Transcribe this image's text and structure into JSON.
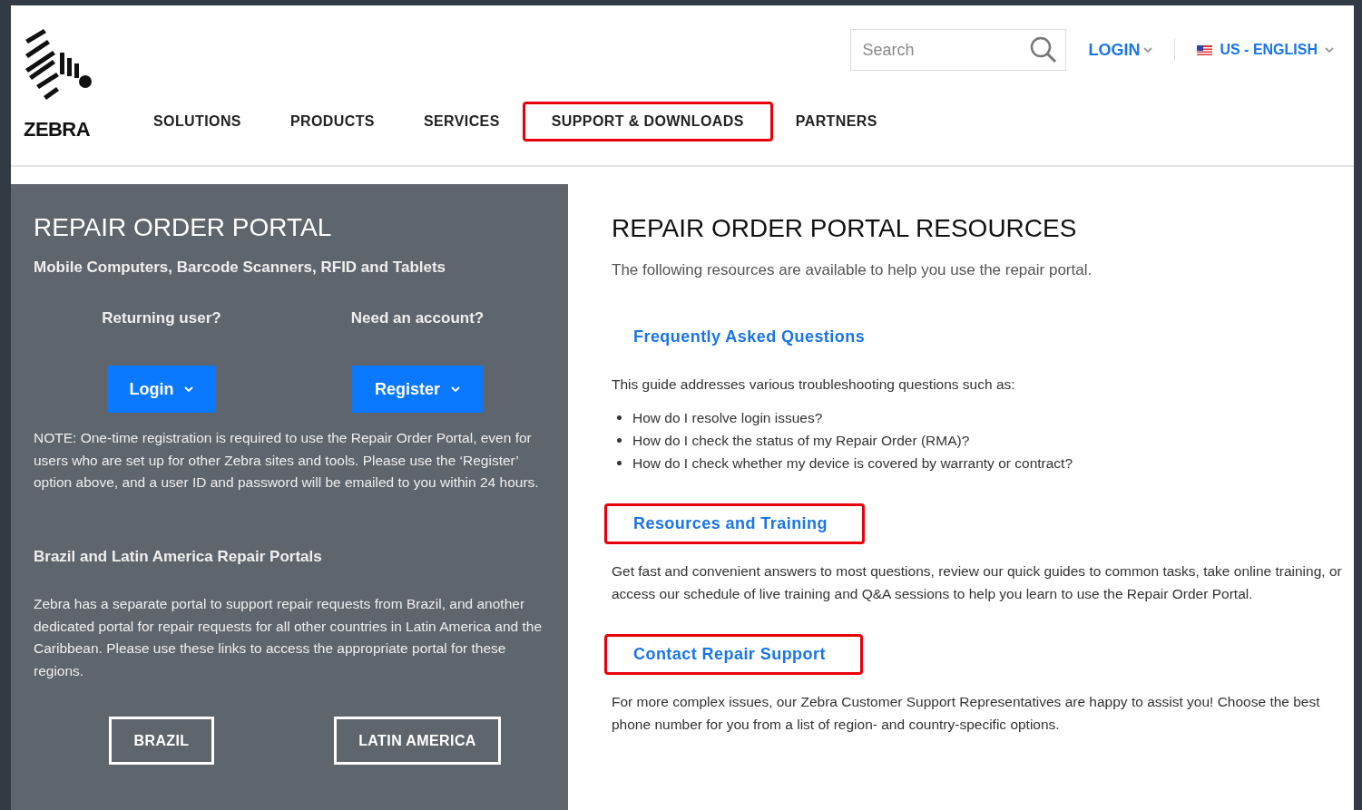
{
  "header": {
    "logo_text": "ZEBRA",
    "search": {
      "placeholder": "Search"
    },
    "login": "LOGIN",
    "language": "US - ENGLISH",
    "nav": [
      {
        "label": "SOLUTIONS",
        "highlighted": false
      },
      {
        "label": "PRODUCTS",
        "highlighted": false
      },
      {
        "label": "SERVICES",
        "highlighted": false
      },
      {
        "label": "SUPPORT & DOWNLOADS",
        "highlighted": true
      },
      {
        "label": "PARTNERS",
        "highlighted": false
      }
    ]
  },
  "left_panel": {
    "title": "REPAIR ORDER PORTAL",
    "subtitle": "Mobile Computers, Barcode Scanners, RFID and Tablets",
    "actions": [
      {
        "prompt": "Returning user?",
        "button": "Login"
      },
      {
        "prompt": "Need an account?",
        "button": "Register"
      }
    ],
    "note": "NOTE: One-time registration is required to use the Repair Order Portal, even for users who are set up for other Zebra sites and tools. Please use the ‘Register’ option above, and a user ID and password will be emailed to you within 24 hours.",
    "regional_heading": "Brazil and Latin America Repair Portals",
    "regional_text": "Zebra has a separate portal to support repair requests from Brazil, and another dedicated portal for repair requests for all other countries in Latin America and the Caribbean. Please use these links to access the appropriate portal for these regions.",
    "region_buttons": [
      "BRAZIL",
      "LATIN AMERICA"
    ]
  },
  "resources": {
    "title": "REPAIR ORDER PORTAL RESOURCES",
    "intro": "The following resources are available to help you use the repair portal.",
    "sections": [
      {
        "link": "Frequently Asked Questions",
        "highlighted": false,
        "text": "This guide addresses various troubleshooting questions such as:",
        "bullets": [
          "How do I resolve login issues?",
          "How do I check the status of my Repair Order (RMA)?",
          "How do I check whether my device is covered by warranty or contract?"
        ]
      },
      {
        "link": "Resources and Training",
        "highlighted": true,
        "text": "Get fast and convenient answers to most questions, review our quick guides to common tasks, take online training, or access our schedule of live training and Q&A sessions to help you learn to use the Repair Order Portal."
      },
      {
        "link": "Contact Repair Support",
        "highlighted": true,
        "text": "For more complex issues, our Zebra Customer Support Representatives are happy to assist you! Choose the best phone number for you from a list of region- and country-specific options."
      }
    ]
  }
}
